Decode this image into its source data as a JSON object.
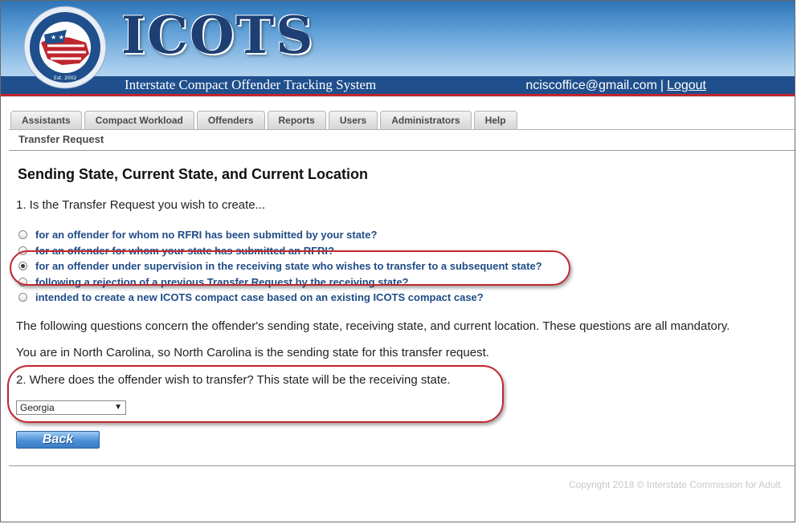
{
  "header": {
    "brand": "ICOTS",
    "subtitle": "Interstate Compact Offender Tracking System",
    "seal_text_top": "Interstate Commission for Adult Offender Supervision",
    "seal_text_bottom": "Est. 2002",
    "user_email": "nciscoffice@gmail.com",
    "separator": "|",
    "logout_label": "Logout"
  },
  "nav": {
    "tabs": [
      "Assistants",
      "Compact Workload",
      "Offenders",
      "Reports",
      "Users",
      "Administrators",
      "Help"
    ],
    "sub_item": "Transfer Request"
  },
  "main": {
    "title": "Sending State, Current State, and Current Location",
    "question1": "1. Is the Transfer Request you wish to create...",
    "options": [
      {
        "label": "for an offender for whom no RFRI has been submitted by your state?",
        "checked": false
      },
      {
        "label": "for an offender for whom your state has submitted an RFRI?",
        "checked": false
      },
      {
        "label": "for an offender under supervision in the receiving state who wishes to transfer to a subsequent state?",
        "checked": true
      },
      {
        "label": "following a rejection of a previous Transfer Request by the receiving state?",
        "checked": false
      },
      {
        "label": "intended to create a new ICOTS compact case based on an existing ICOTS compact case?",
        "checked": false
      }
    ],
    "note1": "The following questions concern the offender's sending state, receiving state, and current location. These questions are all mandatory.",
    "note2": "You are in North Carolina, so North Carolina is the sending state for this transfer request.",
    "question2": "2. Where does the offender wish to transfer? This state will be the receiving state.",
    "state_select": {
      "value": "Georgia",
      "arrow": "▼"
    },
    "back_label": "Back"
  },
  "footer": {
    "copyright": "Copyright 2018 © Interstate Commission for Adult"
  },
  "colors": {
    "brand_blue": "#1f4f8c",
    "accent_red": "#c0262d",
    "option_text": "#1f4c86"
  }
}
